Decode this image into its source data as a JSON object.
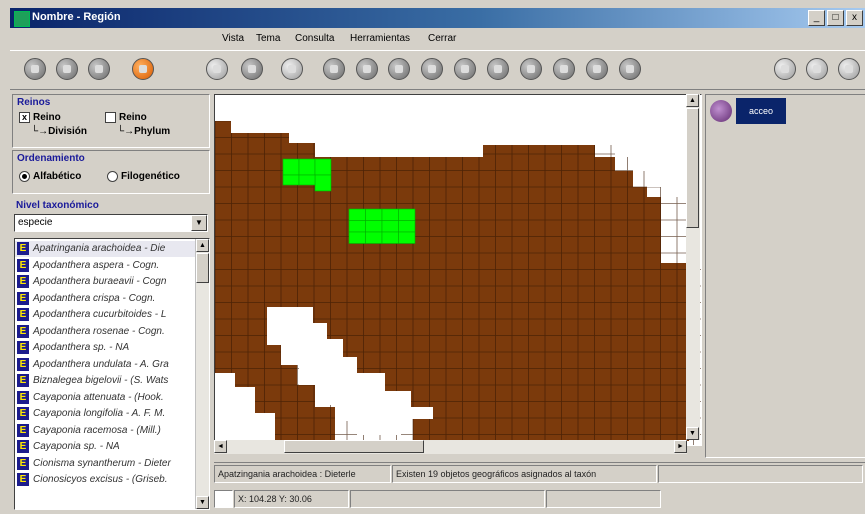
{
  "window": {
    "title": "Nombre - Región",
    "controls": [
      "_",
      "□",
      "x"
    ]
  },
  "menu": [
    "Vista",
    "Tema",
    "Consulta",
    "Herramientas",
    "Cerrar"
  ],
  "toolbar": {
    "icons": [
      "pan-icon",
      "stop-icon",
      "shield-icon",
      "orange-ball-icon",
      "tools-icon",
      "print-icon",
      "globe-icon",
      "zoom-in-icon",
      "zoom-out-icon",
      "fullextent-icon",
      "info-icon",
      "query-icon",
      "layers-icon",
      "arrow-icon",
      "select-icon",
      "clear-icon",
      "help-icon",
      "earth-icon",
      "map-icon",
      "extra-icon"
    ]
  },
  "reinos": {
    "title": "Reinos",
    "opt1_line1": "Reino",
    "opt1_line2": "└→División",
    "opt2_line1": "Reino",
    "opt2_line2": "└→Phylum",
    "opt1_checked": true,
    "opt2_checked": false
  },
  "ordenamiento": {
    "title": "Ordenamiento",
    "opt1": "Alfabético",
    "opt2": "Filogenético",
    "selected": "Alfabético"
  },
  "nivel": {
    "title": "Nivel taxonómico",
    "value": "especie"
  },
  "species_list": [
    "Apatringania arachoidea - Die",
    "Apodanthera aspera - Cogn.",
    "Apodanthera buraeavii - Cogn",
    "Apodanthera crispa - Cogn.",
    "Apodanthera cucurbitoides - L",
    "Apodanthera rosenae - Cogn.",
    "Apodanthera sp. - NA",
    "Apodanthera undulata - A. Gra",
    "Biznalegea bigelovii - (S. Wats",
    "Cayaponia attenuata - (Hook.",
    "Cayaponia longifolia - A. F. M.",
    "Cayaponia racemosa - (Mill.)",
    "Cayaponia sp. - NA",
    "Cionisma synantherum - Dieter",
    "Cionosicyos excisus - (Griseb."
  ],
  "legend": {
    "label": "acceo"
  },
  "status": {
    "taxon": "Apatzingania arachoidea : Dieterle",
    "message": "Existen 19 objetos geográficos asignados al taxón",
    "coords": "X: 104.28 Y: 30.06"
  },
  "colors": {
    "land": "#7b3a0c",
    "grid_line": "#3a1a04",
    "highlight": "#00ff00",
    "water": "#ffffff"
  }
}
